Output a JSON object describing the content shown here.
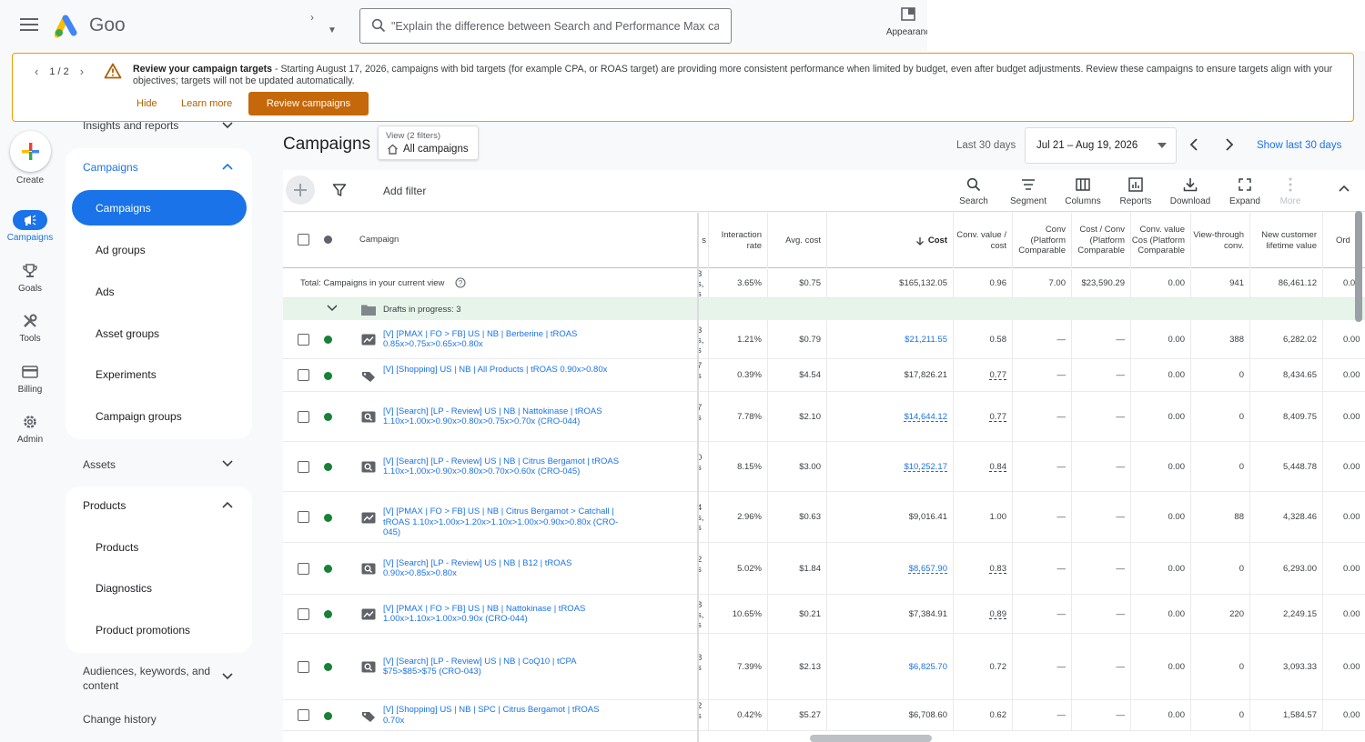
{
  "topbar": {
    "logo_text": "Goog",
    "search_placeholder": "\"Explain the difference between Search and Performance Max cam...",
    "appearance_label": "Appearanc"
  },
  "banner": {
    "pager": "1 / 2",
    "title": "Review your campaign targets",
    "message": " - Starting August 17, 2026, campaigns with bid targets (for example CPA, or ROAS target) are providing more consistent performance when limited by budget, even after budget adjustments. Review these campaigns to ensure targets align with your objectives; targets will not be updated automatically.",
    "hide": "Hide",
    "learn_more": "Learn more",
    "review_button": "Review campaigns"
  },
  "rail": {
    "create": "Create",
    "campaigns": "Campaigns",
    "goals": "Goals",
    "tools": "Tools",
    "billing": "Billing",
    "admin": "Admin"
  },
  "sidenav": {
    "insights": "Insights and reports",
    "campaigns_group": "Campaigns",
    "campaigns_items": [
      "Campaigns",
      "Ad groups",
      "Ads",
      "Asset groups",
      "Experiments",
      "Campaign groups"
    ],
    "assets": "Assets",
    "products_group": "Products",
    "products_items": [
      "Products",
      "Diagnostics",
      "Product promotions"
    ],
    "audiences": "Audiences, keywords, and content",
    "change_history": "Change history"
  },
  "header": {
    "title": "Campaigns",
    "view_filters": "View (2 filters)",
    "view_name": "All campaigns",
    "last_30": "Last 30 days",
    "date_range": "Jul 21 – Aug 19, 2026",
    "show_last": "Show last 30 days"
  },
  "toolbar": {
    "add_filter": "Add filter",
    "buttons": [
      "Search",
      "Segment",
      "Columns",
      "Reports",
      "Download",
      "Expand",
      "More"
    ]
  },
  "table": {
    "headers": {
      "campaign": "Campaign",
      "clipped": "s",
      "interaction_rate": "Interaction rate",
      "avg_cost": "Avg. cost",
      "cost": "Cost",
      "conv_value_cost": "Conv. value / cost",
      "conv_platform": "Conv (Platform Comparable",
      "cost_conv_platform": "Cost / Conv (Platform Comparable",
      "conv_value_cost_platform": "Conv. value Cos (Platform Comparable",
      "view_through": "View-through conv.",
      "new_customer_ltv": "New customer lifetime value",
      "orders": "Ord"
    },
    "total": {
      "label": "Total: Campaigns in your current view",
      "clipped": "3\ns,\ns",
      "interaction_rate": "3.65%",
      "avg_cost": "$0.75",
      "cost": "$165,132.05",
      "conv_value_cost": "0.96",
      "conv_platform": "7.00",
      "cost_conv_platform": "$23,590.29",
      "conv_value_cost_platform": "0.00",
      "view_through": "941",
      "new_customer_ltv": "86,461.12",
      "orders": "0.0"
    },
    "drafts": "Drafts in progress: 3",
    "rows": [
      {
        "name": "[V] [PMAX | FO > FB] US | NB | Berberine | tROAS 0.85x>0.75x>0.65x>0.80x",
        "type": "pmax",
        "clipped": "3\ns,\ns",
        "interaction_rate": "1.21%",
        "avg_cost": "$0.79",
        "cost": "$21,211.55",
        "conv_value_cost": "0.58",
        "conv_platform": "—",
        "cost_conv_platform": "—",
        "conv_value_cost_platform": "0.00",
        "view_through": "388",
        "new_customer_ltv": "6,282.02",
        "orders": "0.00"
      },
      {
        "name": "[V] [Shopping] US | NB | All Products | tROAS 0.90x>0.80x",
        "type": "shopping",
        "clipped": "7\ns",
        "interaction_rate": "0.39%",
        "avg_cost": "$4.54",
        "cost": "$17,826.21",
        "conv_value_cost": "0.77",
        "conv_platform": "—",
        "cost_conv_platform": "—",
        "conv_value_cost_platform": "0.00",
        "view_through": "0",
        "new_customer_ltv": "8,434.65",
        "orders": "0.00"
      },
      {
        "name": "[V] [Search] [LP - Review] US | NB | Nattokinase | tROAS 1.10x>1.00x>0.90x>0.80x>0.75x>0.70x (CRO-044)",
        "type": "search",
        "clipped": "7\ns",
        "interaction_rate": "7.78%",
        "avg_cost": "$2.10",
        "cost": "$14,644.12",
        "conv_value_cost": "0.77",
        "conv_platform": "—",
        "cost_conv_platform": "—",
        "conv_value_cost_platform": "0.00",
        "view_through": "0",
        "new_customer_ltv": "8,409.75",
        "orders": "0.00"
      },
      {
        "name": "[V] [Search] [LP - Review] US | NB | Citrus Bergamot | tROAS 1.10x>1.00x>0.90x>0.80x>0.70x>0.60x (CRO-045)",
        "type": "search",
        "clipped": "0\ns",
        "interaction_rate": "8.15%",
        "avg_cost": "$3.00",
        "cost": "$10,252.17",
        "conv_value_cost": "0.84",
        "conv_platform": "—",
        "cost_conv_platform": "—",
        "conv_value_cost_platform": "0.00",
        "view_through": "0",
        "new_customer_ltv": "5,448.78",
        "orders": "0.00"
      },
      {
        "name": "[V] [PMAX | FO > FB] US | NB | Citrus Bergamot > Catchall | tROAS 1.10x>1.00x>1.20x>1.10x>1.00x>0.90x>0.80x (CRO-045)",
        "type": "pmax",
        "clipped": "4\ns,\ns",
        "interaction_rate": "2.96%",
        "avg_cost": "$0.63",
        "cost": "$9,016.41",
        "conv_value_cost": "1.00",
        "conv_platform": "—",
        "cost_conv_platform": "—",
        "conv_value_cost_platform": "0.00",
        "view_through": "88",
        "new_customer_ltv": "4,328.46",
        "orders": "0.00"
      },
      {
        "name": "[V] [Search] [LP - Review] US | NB | B12 | tROAS 0.90x>0.85x>0.80x",
        "type": "search",
        "clipped": "2\ns",
        "interaction_rate": "5.02%",
        "avg_cost": "$1.84",
        "cost": "$8,657.90",
        "conv_value_cost": "0.83",
        "conv_platform": "—",
        "cost_conv_platform": "—",
        "conv_value_cost_platform": "0.00",
        "view_through": "0",
        "new_customer_ltv": "6,293.00",
        "orders": "0.00"
      },
      {
        "name": "[V] [PMAX | FO > FB] US | NB | Nattokinase | tROAS 1.00x>1.10x>1.00x>0.90x (CRO-044)",
        "type": "pmax",
        "clipped": "8\ns,\ns",
        "interaction_rate": "10.65%",
        "avg_cost": "$0.21",
        "cost": "$7,384.91",
        "conv_value_cost": "0.89",
        "conv_platform": "—",
        "cost_conv_platform": "—",
        "conv_value_cost_platform": "0.00",
        "view_through": "220",
        "new_customer_ltv": "2,249.15",
        "orders": "0.00"
      },
      {
        "name": "[V] [Search] [LP - Review] US | NB | CoQ10 | tCPA $75>$85>$75 (CRO-043)",
        "type": "search",
        "clipped": "8\ns",
        "interaction_rate": "7.39%",
        "avg_cost": "$2.13",
        "cost": "$6,825.70",
        "conv_value_cost": "0.72",
        "conv_platform": "—",
        "cost_conv_platform": "—",
        "conv_value_cost_platform": "0.00",
        "view_through": "0",
        "new_customer_ltv": "3,093.33",
        "orders": "0.00"
      },
      {
        "name": "[V] [Shopping] US | NB | SPC | Citrus Bergamot | tROAS 0.70x",
        "type": "shopping",
        "clipped": "2\ns",
        "interaction_rate": "0.42%",
        "avg_cost": "$5.27",
        "cost": "$6,708.60",
        "conv_value_cost": "0.62",
        "conv_platform": "—",
        "cost_conv_platform": "—",
        "conv_value_cost_platform": "0.00",
        "view_through": "0",
        "new_customer_ltv": "1,584.57",
        "orders": "0.00"
      }
    ]
  },
  "colors": {
    "accent": "#1a73e8",
    "status_enabled": "#188038",
    "banner_border": "#f29900",
    "banner_button": "#c5680b"
  }
}
